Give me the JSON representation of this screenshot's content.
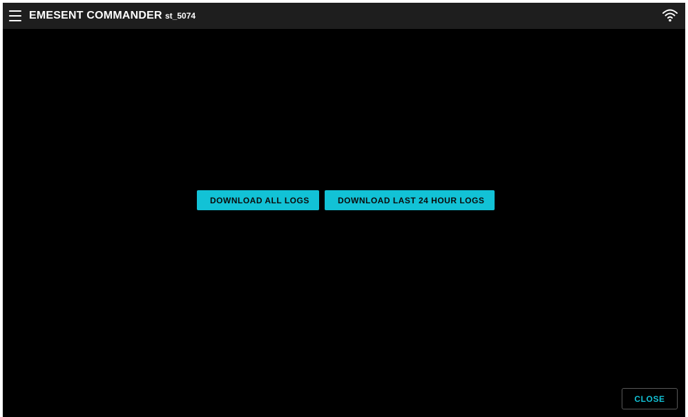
{
  "header": {
    "title": "EMESENT COMMANDER",
    "device_id": "st_5074",
    "menu_icon": "hamburger-menu-icon",
    "status_icon": "wifi-icon"
  },
  "main": {
    "download_all_label": "DOWNLOAD ALL LOGS",
    "download_24h_label": "DOWNLOAD LAST 24 HOUR LOGS"
  },
  "footer": {
    "close_label": "CLOSE"
  },
  "colors": {
    "accent": "#12c2d6",
    "background": "#000000",
    "topbar": "#1e1e1e"
  }
}
